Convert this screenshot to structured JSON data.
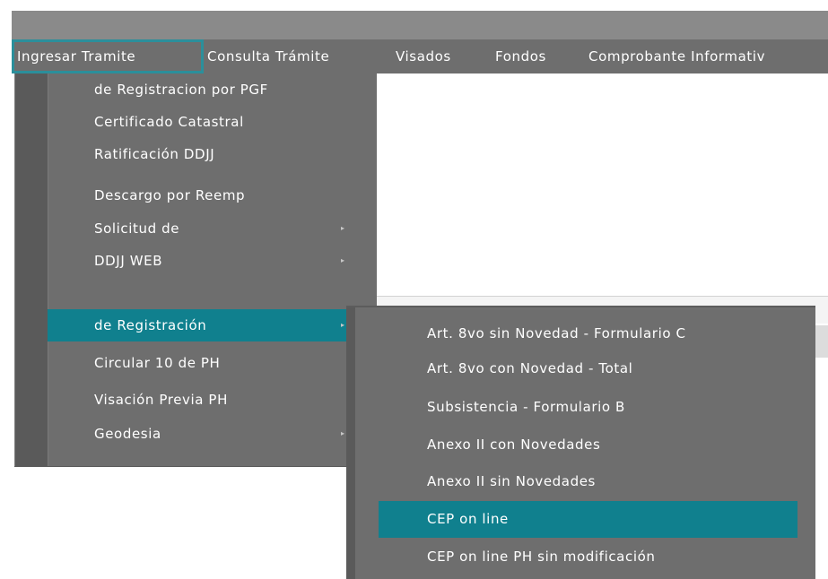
{
  "menubar": {
    "items": [
      {
        "label": "Ingresar Tramite"
      },
      {
        "label": "Consulta Trámite"
      },
      {
        "label": "Visados"
      },
      {
        "label": "Fondos"
      },
      {
        "label": "Comprobante Informativ"
      }
    ],
    "active_index": 0
  },
  "dropdown": {
    "items": [
      {
        "label": "de Registracion por PGF"
      },
      {
        "label": "Certificado Catastral"
      },
      {
        "label": "Ratificación DDJJ"
      },
      {
        "label": "Descargo por Reemp"
      },
      {
        "label": "Solicitud de",
        "has_submenu": true
      },
      {
        "label": "DDJJ WEB",
        "has_submenu": true
      },
      {
        "label": "de Registración",
        "has_submenu": true,
        "highlighted": true
      },
      {
        "label": "Circular 10 de PH"
      },
      {
        "label": "Visación Previa PH"
      },
      {
        "label": "Geodesia",
        "has_submenu": true
      }
    ],
    "submenu_arrow": "▸"
  },
  "submenu": {
    "items": [
      {
        "label": "Art. 8vo sin Novedad - Formulario C"
      },
      {
        "label": "Art. 8vo con Novedad - Total"
      },
      {
        "label": "Subsistencia - Formulario B"
      },
      {
        "label": "Anexo II con Novedades"
      },
      {
        "label": "Anexo II sin Novedades"
      },
      {
        "label": "CEP on line",
        "highlighted": true
      },
      {
        "label": "CEP on line PH sin modificación"
      }
    ]
  },
  "colors": {
    "menu_bg": "#6e6e6e",
    "highlight": "#10808e",
    "active_outline": "#2b8f9b",
    "text": "#ffffff"
  }
}
